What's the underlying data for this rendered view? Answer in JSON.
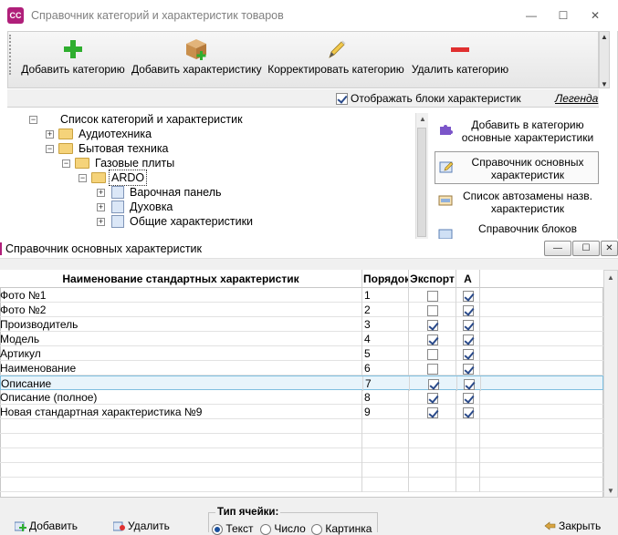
{
  "window": {
    "logo_text": "СС",
    "title": "Справочник категорий и характеристик товаров",
    "controls": {
      "minimize": "—",
      "maximize": "☐",
      "close": "✕"
    }
  },
  "toolbar": {
    "add_category": "Добавить категорию",
    "add_characteristic": "Добавить характеристику",
    "edit_category": "Корректировать категорию",
    "delete_category": "Удалить категорию"
  },
  "options": {
    "show_blocks_label": "Отображать блоки характеристик",
    "show_blocks_checked": true,
    "legend_link": "Легенда"
  },
  "tree": {
    "root": "Список категорий и характеристик",
    "items": [
      {
        "label": "Аудиотехника",
        "expander": "+"
      },
      {
        "label": "Бытовая техника",
        "expander": "−"
      },
      {
        "label": "Газовые плиты",
        "expander": "−"
      },
      {
        "label": "ARDO",
        "expander": "−"
      },
      {
        "label": "Варочная панель",
        "expander": "+"
      },
      {
        "label": "Духовка",
        "expander": "+"
      },
      {
        "label": "Общие характеристики",
        "expander": "+"
      }
    ]
  },
  "right_panel": {
    "buttons": [
      "Добавить в категорию основные характеристики",
      "Справочник основных характеристик",
      "Список автозамены назв. характеристик",
      "Справочник блоков"
    ]
  },
  "dialog": {
    "title": "Справочник основных характеристик",
    "controls": {
      "minimize": "—",
      "maximize": "☐",
      "close": "✕"
    },
    "columns": [
      "Наименование стандартных характеристик",
      "Порядок",
      "Экспорт",
      "А"
    ],
    "rows": [
      {
        "name": "Фото №1",
        "order": "1",
        "export": false,
        "a": true
      },
      {
        "name": "Фото №2",
        "order": "2",
        "export": false,
        "a": true
      },
      {
        "name": "Производитель",
        "order": "3",
        "export": true,
        "a": true
      },
      {
        "name": "Модель",
        "order": "4",
        "export": true,
        "a": true
      },
      {
        "name": "Артикул",
        "order": "5",
        "export": false,
        "a": true
      },
      {
        "name": "Наименование",
        "order": "6",
        "export": false,
        "a": true
      },
      {
        "name": "Описание",
        "order": "7",
        "export": true,
        "a": true,
        "selected": true
      },
      {
        "name": "Описание (полное)",
        "order": "8",
        "export": true,
        "a": true
      },
      {
        "name": "Новая стандартная характеристика №9",
        "order": "9",
        "export": true,
        "a": true
      }
    ],
    "bottom": {
      "add": "Добавить",
      "delete": "Удалить",
      "cell_type_legend": "Тип ячейки:",
      "cell_types": [
        "Текст",
        "Число",
        "Картинка"
      ],
      "cell_type_selected": "Текст",
      "close": "Закрыть"
    }
  },
  "colors": {
    "logo": "#b01f7a",
    "add_green": "#2fae2f",
    "delete_red": "#e03030",
    "highlight_row": "#e8f4fb",
    "folder": "#f5d37a"
  }
}
